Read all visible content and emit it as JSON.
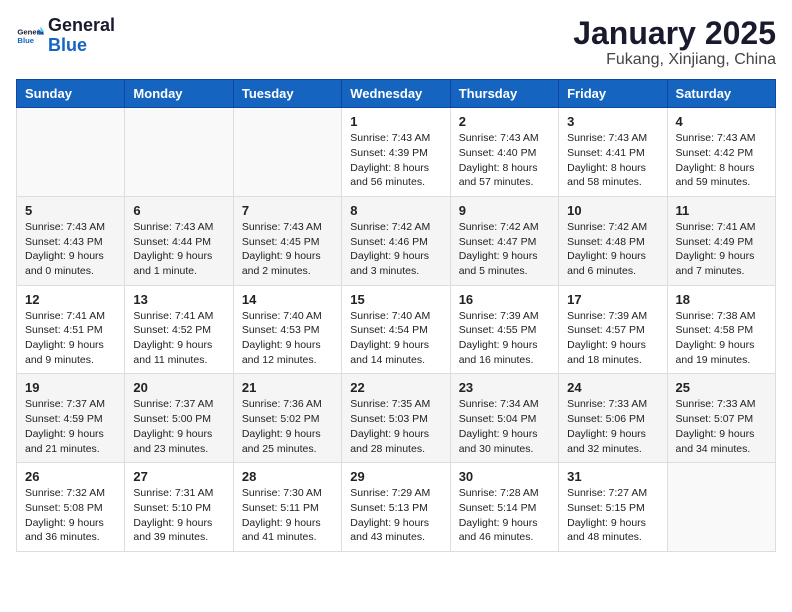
{
  "logo": {
    "general": "General",
    "blue": "Blue"
  },
  "header": {
    "month": "January 2025",
    "location": "Fukang, Xinjiang, China"
  },
  "weekdays": [
    "Sunday",
    "Monday",
    "Tuesday",
    "Wednesday",
    "Thursday",
    "Friday",
    "Saturday"
  ],
  "weeks": [
    [
      {
        "day": "",
        "info": ""
      },
      {
        "day": "",
        "info": ""
      },
      {
        "day": "",
        "info": ""
      },
      {
        "day": "1",
        "info": "Sunrise: 7:43 AM\nSunset: 4:39 PM\nDaylight: 8 hours and 56 minutes."
      },
      {
        "day": "2",
        "info": "Sunrise: 7:43 AM\nSunset: 4:40 PM\nDaylight: 8 hours and 57 minutes."
      },
      {
        "day": "3",
        "info": "Sunrise: 7:43 AM\nSunset: 4:41 PM\nDaylight: 8 hours and 58 minutes."
      },
      {
        "day": "4",
        "info": "Sunrise: 7:43 AM\nSunset: 4:42 PM\nDaylight: 8 hours and 59 minutes."
      }
    ],
    [
      {
        "day": "5",
        "info": "Sunrise: 7:43 AM\nSunset: 4:43 PM\nDaylight: 9 hours and 0 minutes."
      },
      {
        "day": "6",
        "info": "Sunrise: 7:43 AM\nSunset: 4:44 PM\nDaylight: 9 hours and 1 minute."
      },
      {
        "day": "7",
        "info": "Sunrise: 7:43 AM\nSunset: 4:45 PM\nDaylight: 9 hours and 2 minutes."
      },
      {
        "day": "8",
        "info": "Sunrise: 7:42 AM\nSunset: 4:46 PM\nDaylight: 9 hours and 3 minutes."
      },
      {
        "day": "9",
        "info": "Sunrise: 7:42 AM\nSunset: 4:47 PM\nDaylight: 9 hours and 5 minutes."
      },
      {
        "day": "10",
        "info": "Sunrise: 7:42 AM\nSunset: 4:48 PM\nDaylight: 9 hours and 6 minutes."
      },
      {
        "day": "11",
        "info": "Sunrise: 7:41 AM\nSunset: 4:49 PM\nDaylight: 9 hours and 7 minutes."
      }
    ],
    [
      {
        "day": "12",
        "info": "Sunrise: 7:41 AM\nSunset: 4:51 PM\nDaylight: 9 hours and 9 minutes."
      },
      {
        "day": "13",
        "info": "Sunrise: 7:41 AM\nSunset: 4:52 PM\nDaylight: 9 hours and 11 minutes."
      },
      {
        "day": "14",
        "info": "Sunrise: 7:40 AM\nSunset: 4:53 PM\nDaylight: 9 hours and 12 minutes."
      },
      {
        "day": "15",
        "info": "Sunrise: 7:40 AM\nSunset: 4:54 PM\nDaylight: 9 hours and 14 minutes."
      },
      {
        "day": "16",
        "info": "Sunrise: 7:39 AM\nSunset: 4:55 PM\nDaylight: 9 hours and 16 minutes."
      },
      {
        "day": "17",
        "info": "Sunrise: 7:39 AM\nSunset: 4:57 PM\nDaylight: 9 hours and 18 minutes."
      },
      {
        "day": "18",
        "info": "Sunrise: 7:38 AM\nSunset: 4:58 PM\nDaylight: 9 hours and 19 minutes."
      }
    ],
    [
      {
        "day": "19",
        "info": "Sunrise: 7:37 AM\nSunset: 4:59 PM\nDaylight: 9 hours and 21 minutes."
      },
      {
        "day": "20",
        "info": "Sunrise: 7:37 AM\nSunset: 5:00 PM\nDaylight: 9 hours and 23 minutes."
      },
      {
        "day": "21",
        "info": "Sunrise: 7:36 AM\nSunset: 5:02 PM\nDaylight: 9 hours and 25 minutes."
      },
      {
        "day": "22",
        "info": "Sunrise: 7:35 AM\nSunset: 5:03 PM\nDaylight: 9 hours and 28 minutes."
      },
      {
        "day": "23",
        "info": "Sunrise: 7:34 AM\nSunset: 5:04 PM\nDaylight: 9 hours and 30 minutes."
      },
      {
        "day": "24",
        "info": "Sunrise: 7:33 AM\nSunset: 5:06 PM\nDaylight: 9 hours and 32 minutes."
      },
      {
        "day": "25",
        "info": "Sunrise: 7:33 AM\nSunset: 5:07 PM\nDaylight: 9 hours and 34 minutes."
      }
    ],
    [
      {
        "day": "26",
        "info": "Sunrise: 7:32 AM\nSunset: 5:08 PM\nDaylight: 9 hours and 36 minutes."
      },
      {
        "day": "27",
        "info": "Sunrise: 7:31 AM\nSunset: 5:10 PM\nDaylight: 9 hours and 39 minutes."
      },
      {
        "day": "28",
        "info": "Sunrise: 7:30 AM\nSunset: 5:11 PM\nDaylight: 9 hours and 41 minutes."
      },
      {
        "day": "29",
        "info": "Sunrise: 7:29 AM\nSunset: 5:13 PM\nDaylight: 9 hours and 43 minutes."
      },
      {
        "day": "30",
        "info": "Sunrise: 7:28 AM\nSunset: 5:14 PM\nDaylight: 9 hours and 46 minutes."
      },
      {
        "day": "31",
        "info": "Sunrise: 7:27 AM\nSunset: 5:15 PM\nDaylight: 9 hours and 48 minutes."
      },
      {
        "day": "",
        "info": ""
      }
    ]
  ]
}
